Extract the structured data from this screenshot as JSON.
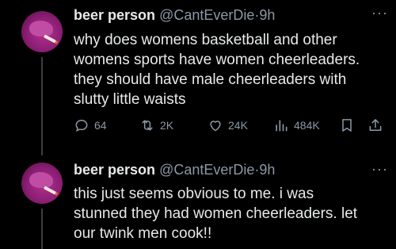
{
  "tweets": [
    {
      "display_name": "beer person",
      "handle": "@CantEverDie",
      "separator": "·",
      "time": "9h",
      "more": "···",
      "text": "why does womens basketball and other\nwomens sports have women cheerleaders.\nthey should have male cheerleaders  with\nslutty little waists",
      "stats": {
        "replies": "64",
        "retweets": "2K",
        "likes": "24K",
        "views": "484K"
      }
    },
    {
      "display_name": "beer person",
      "handle": "@CantEverDie",
      "separator": "·",
      "time": "9h",
      "more": "···",
      "text": "this just seems obvious to me.  i was\nstunned they had women cheerleaders.  let\nour twink men cook!!"
    }
  ],
  "icons": {
    "reply": "reply-icon",
    "retweet": "retweet-icon",
    "like": "heart-icon",
    "views": "views-icon",
    "bookmark": "bookmark-icon",
    "share": "share-icon"
  },
  "colors": {
    "background": "#000000",
    "text": "#e7e9ea",
    "muted": "#8b98a5",
    "thread_line": "#3a3d41"
  }
}
